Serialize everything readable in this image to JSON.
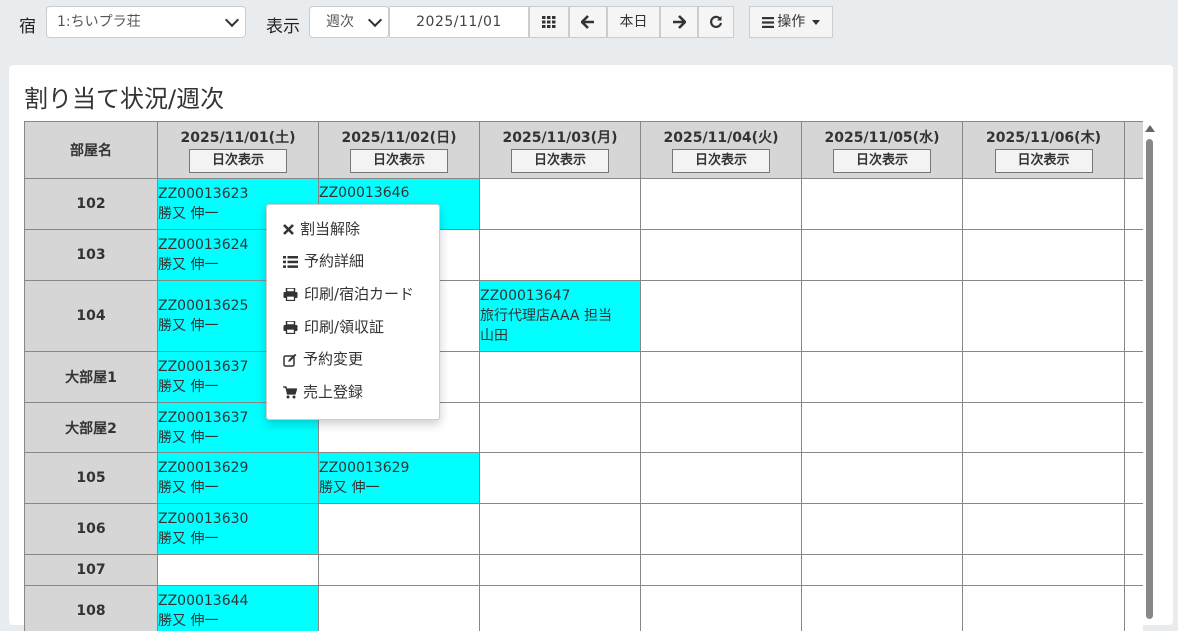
{
  "toolbar": {
    "inn_label": "宿",
    "inn_select": "1:ちいプラ荘",
    "view_label": "表示",
    "view_select": "週次",
    "date": "2025/11/01",
    "today_label": "本日",
    "operations_label": "操作"
  },
  "panel": {
    "title": "割り当て状況/週次"
  },
  "grid": {
    "room_header": "部屋名",
    "day_button_label": "日次表示",
    "days": [
      "2025/11/01(土)",
      "2025/11/02(日)",
      "2025/11/03(月)",
      "2025/11/04(火)",
      "2025/11/05(水)",
      "2025/11/06(木)"
    ],
    "rooms": [
      "102",
      "103",
      "104",
      "大部屋1",
      "大部屋2",
      "105",
      "106",
      "107",
      "108"
    ],
    "bookings": [
      {
        "id": "ZZ00013623",
        "guest": "勝又 伸一"
      },
      {
        "id": "ZZ00013646",
        "guest": ""
      },
      {
        "id": "ZZ00013624",
        "guest": "勝又 伸一"
      },
      {
        "id": "ZZ00013625",
        "guest": "勝又 伸一"
      },
      {
        "id": "ZZ00013647",
        "guest": "旅行代理店AAA 担当 山田"
      },
      {
        "id": "ZZ00013637",
        "guest": "勝又 伸一"
      },
      {
        "id": "ZZ00013637",
        "guest": "勝又 伸一"
      },
      {
        "id": "ZZ00013629",
        "guest": "勝又 伸一"
      },
      {
        "id": "ZZ00013629",
        "guest": "勝又 伸一"
      },
      {
        "id": "ZZ00013630",
        "guest": "勝又 伸一"
      },
      {
        "id": "ZZ00013644",
        "guest": "勝又 伸一"
      }
    ]
  },
  "context_menu": {
    "items": [
      {
        "label": "割当解除",
        "icon": "times-icon"
      },
      {
        "label": "予約詳細",
        "icon": "list-icon"
      },
      {
        "label": "印刷/宿泊カード",
        "icon": "print-icon"
      },
      {
        "label": "印刷/領収証",
        "icon": "print-icon"
      },
      {
        "label": "予約変更",
        "icon": "edit-icon"
      },
      {
        "label": "売上登録",
        "icon": "cart-icon"
      }
    ]
  },
  "colors": {
    "booked": "#00ffff",
    "header": "#d6d6d6",
    "page": "#e9ecef"
  }
}
